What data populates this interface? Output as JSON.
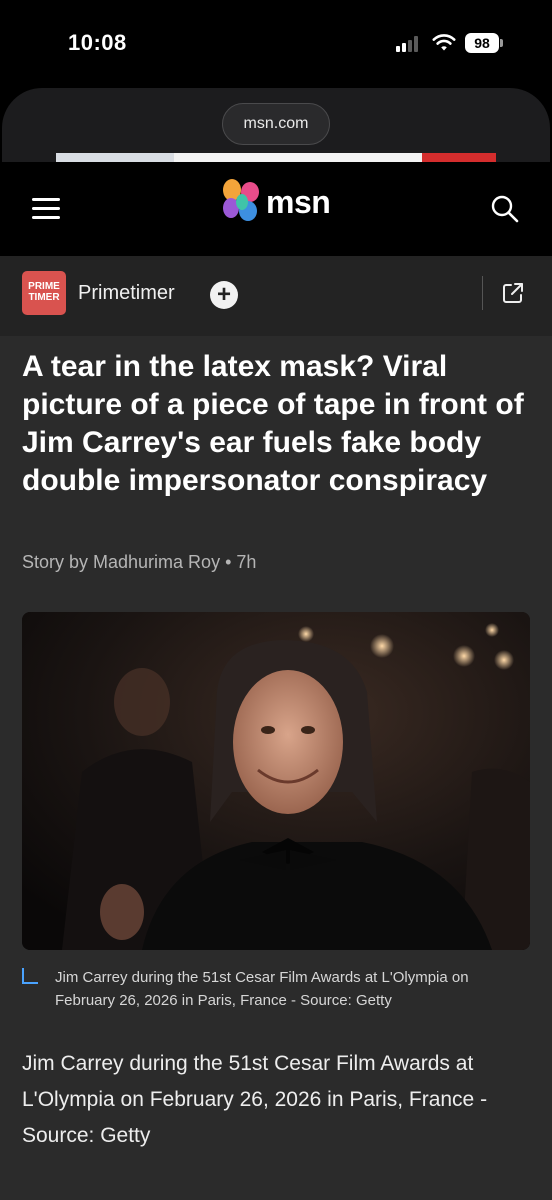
{
  "status_bar": {
    "time": "10:08",
    "battery": "98"
  },
  "browser": {
    "url": "msn.com"
  },
  "header": {
    "logo_text": "msn",
    "menu_icon": "hamburger-menu-icon",
    "search_icon": "search-icon"
  },
  "publisher": {
    "logo_line1": "PRIME",
    "logo_line2": "TIMER",
    "name": "Primetimer",
    "follow_symbol": "+",
    "follow_icon": "plus-circle-icon",
    "share_icon": "open-external-icon"
  },
  "article": {
    "headline": "A tear in the latex mask? Viral picture of a piece of tape in front of Jim Carrey's ear fuels fake body double impersonator conspiracy",
    "byline": "Story by Madhurima Roy • 7h",
    "image_caption": "Jim Carrey during the 51st Cesar Film Awards at L'Olympia on February 26, 2026 in Paris, France - Source: Getty",
    "body": "Jim Carrey during the 51st Cesar Film Awards at L'Olympia on February 26, 2026 in Paris, France - Source: Getty"
  },
  "colors": {
    "background": "#2b2b2b",
    "publisher_bar": "#232323",
    "publisher_logo": "#d9534f",
    "caption_accent": "#4aa3ff"
  }
}
